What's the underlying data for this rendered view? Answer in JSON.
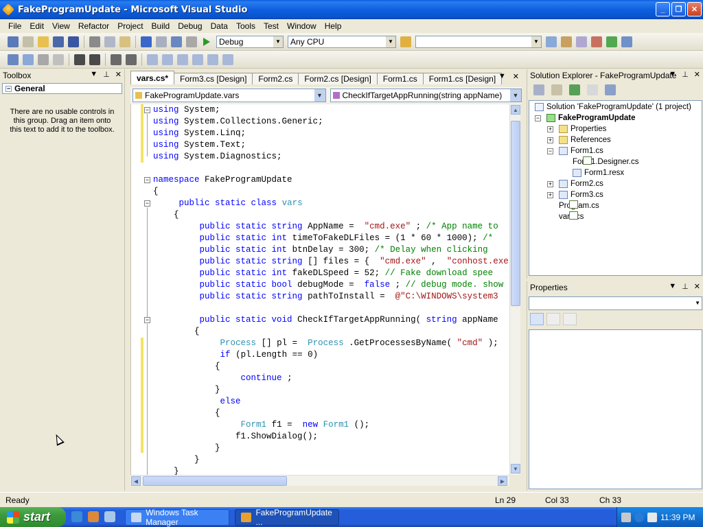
{
  "window": {
    "title": "FakeProgramUpdate - Microsoft Visual Studio"
  },
  "menu": [
    "File",
    "Edit",
    "View",
    "Refactor",
    "Project",
    "Build",
    "Debug",
    "Data",
    "Tools",
    "Test",
    "Window",
    "Help"
  ],
  "toolbar": {
    "config": "Debug",
    "platform": "Any CPU",
    "find_value": ""
  },
  "toolbox": {
    "title": "Toolbox",
    "group": "General",
    "empty_message": "There are no usable controls in this group. Drag an item onto this text to add it to the toolbox."
  },
  "tabs": [
    "vars.cs*",
    "Form3.cs [Design]",
    "Form2.cs",
    "Form2.cs [Design]",
    "Form1.cs",
    "Form1.cs [Design]"
  ],
  "nav": {
    "class": "FakeProgramUpdate.vars",
    "member": "CheckIfTargetAppRunning(string appName)"
  },
  "code_lines": [
    [
      [
        "kw",
        "using"
      ],
      [
        "",
        "System;"
      ]
    ],
    [
      [
        "kw",
        "using"
      ],
      [
        "",
        "System.Collections.Generic;"
      ]
    ],
    [
      [
        "kw",
        "using"
      ],
      [
        "",
        "System.Linq;"
      ]
    ],
    [
      [
        "kw",
        "using"
      ],
      [
        "",
        "System.Text;"
      ]
    ],
    [
      [
        "kw",
        "using"
      ],
      [
        "",
        "System.Diagnostics;"
      ]
    ],
    [],
    [
      [
        "kw",
        "namespace"
      ],
      [
        "",
        "FakeProgramUpdate"
      ]
    ],
    [
      [
        "",
        "{"
      ]
    ],
    [
      [
        "",
        "    "
      ],
      [
        "kw",
        "public static class"
      ],
      [
        "ty",
        "vars"
      ]
    ],
    [
      [
        "",
        "    {"
      ]
    ],
    [
      [
        "",
        "        "
      ],
      [
        "kw",
        "public static string"
      ],
      [
        "",
        "AppName = "
      ],
      [
        "st",
        "\"cmd.exe\""
      ],
      [
        "",
        ";"
      ],
      [
        "cm",
        "/* App name to"
      ]
    ],
    [
      [
        "",
        "        "
      ],
      [
        "kw",
        "public static int"
      ],
      [
        "",
        "timeToFakeDLFiles = (1 * 60 * 1000);"
      ],
      [
        "cm",
        "/*"
      ]
    ],
    [
      [
        "",
        "        "
      ],
      [
        "kw",
        "public static int"
      ],
      [
        "",
        "btnDelay = 300;"
      ],
      [
        "cm",
        "/* Delay when clicking"
      ]
    ],
    [
      [
        "",
        "        "
      ],
      [
        "kw",
        "public static string"
      ],
      [
        "",
        "[] files = { "
      ],
      [
        "st",
        "\"cmd.exe\""
      ],
      [
        "",
        ", "
      ],
      [
        "st",
        "\"conhost.exe\""
      ]
    ],
    [
      [
        "",
        "        "
      ],
      [
        "kw",
        "public static int"
      ],
      [
        "",
        "fakeDLSpeed = 52;"
      ],
      [
        "cm",
        "// Fake download spee"
      ]
    ],
    [
      [
        "",
        "        "
      ],
      [
        "kw",
        "public static bool"
      ],
      [
        "",
        "debugMode = "
      ],
      [
        "kw",
        "false"
      ],
      [
        "",
        ";"
      ],
      [
        "cm",
        "// debug mode. show"
      ]
    ],
    [
      [
        "",
        "        "
      ],
      [
        "kw",
        "public static string"
      ],
      [
        "",
        "pathToInstall = "
      ],
      [
        "st",
        "@\"C:\\WINDOWS\\system3"
      ]
    ],
    [],
    [
      [
        "",
        "        "
      ],
      [
        "kw",
        "public static void"
      ],
      [
        "",
        "CheckIfTargetAppRunning("
      ],
      [
        "kw",
        "string"
      ],
      [
        "",
        "appName"
      ]
    ],
    [
      [
        "",
        "        {"
      ]
    ],
    [
      [
        "",
        "            "
      ],
      [
        "ty",
        "Process"
      ],
      [
        "",
        "[] pl = "
      ],
      [
        "ty",
        "Process"
      ],
      [
        "",
        ".GetProcessesByName("
      ],
      [
        "st",
        "\"cmd\""
      ],
      [
        "",
        ");"
      ]
    ],
    [
      [
        "",
        "            "
      ],
      [
        "kw",
        "if"
      ],
      [
        "",
        "(pl.Length == 0)"
      ]
    ],
    [
      [
        "",
        "            {"
      ]
    ],
    [
      [
        "",
        "                "
      ],
      [
        "kw",
        "continue"
      ],
      [
        "",
        ";"
      ]
    ],
    [
      [
        "",
        "            }"
      ]
    ],
    [
      [
        "",
        "            "
      ],
      [
        "kw",
        "else"
      ]
    ],
    [
      [
        "",
        "            {"
      ]
    ],
    [
      [
        "",
        "                "
      ],
      [
        "ty",
        "Form1"
      ],
      [
        "",
        "f1 = "
      ],
      [
        "kw",
        "new"
      ],
      [
        "ty",
        "Form1"
      ],
      [
        "",
        "();"
      ]
    ],
    [
      [
        "",
        "                f1.ShowDialog();"
      ]
    ],
    [
      [
        "",
        "            }"
      ]
    ],
    [
      [
        "",
        "        }"
      ]
    ],
    [
      [
        "",
        "    }"
      ]
    ]
  ],
  "solution_explorer": {
    "title": "Solution Explorer - FakeProgramUpdate",
    "items": [
      {
        "label": "Solution 'FakeProgramUpdate' (1 project)",
        "icon": "solution-icon"
      },
      {
        "label": "FakeProgramUpdate",
        "icon": "project-icon",
        "bold": true,
        "toggle": "-"
      },
      {
        "label": "Properties",
        "icon": "folder-icon",
        "toggle": "+"
      },
      {
        "label": "References",
        "icon": "references-icon",
        "toggle": "+"
      },
      {
        "label": "Form1.cs",
        "icon": "form-icon",
        "toggle": "-"
      },
      {
        "label": "Form1.Designer.cs",
        "icon": "code-file-icon"
      },
      {
        "label": "Form1.resx",
        "icon": "resource-file-icon"
      },
      {
        "label": "Form2.cs",
        "icon": "form-icon",
        "toggle": "+"
      },
      {
        "label": "Form3.cs",
        "icon": "form-icon",
        "toggle": "+"
      },
      {
        "label": "Program.cs",
        "icon": "code-file-icon"
      },
      {
        "label": "vars.cs",
        "icon": "code-file-icon"
      }
    ]
  },
  "properties": {
    "title": "Properties"
  },
  "status": {
    "text": "Ready",
    "line": "Ln 29",
    "col": "Col 33",
    "ch": "Ch 33"
  },
  "taskbar": {
    "start": "start",
    "items": [
      "Windows Task Manager",
      "FakeProgramUpdate ..."
    ],
    "clock": "11:39 PM"
  },
  "colors": {
    "keyword": "#0000ff",
    "type": "#2b91af",
    "string": "#a31515",
    "comment": "#008000",
    "titlebar": "#0a5ede"
  }
}
